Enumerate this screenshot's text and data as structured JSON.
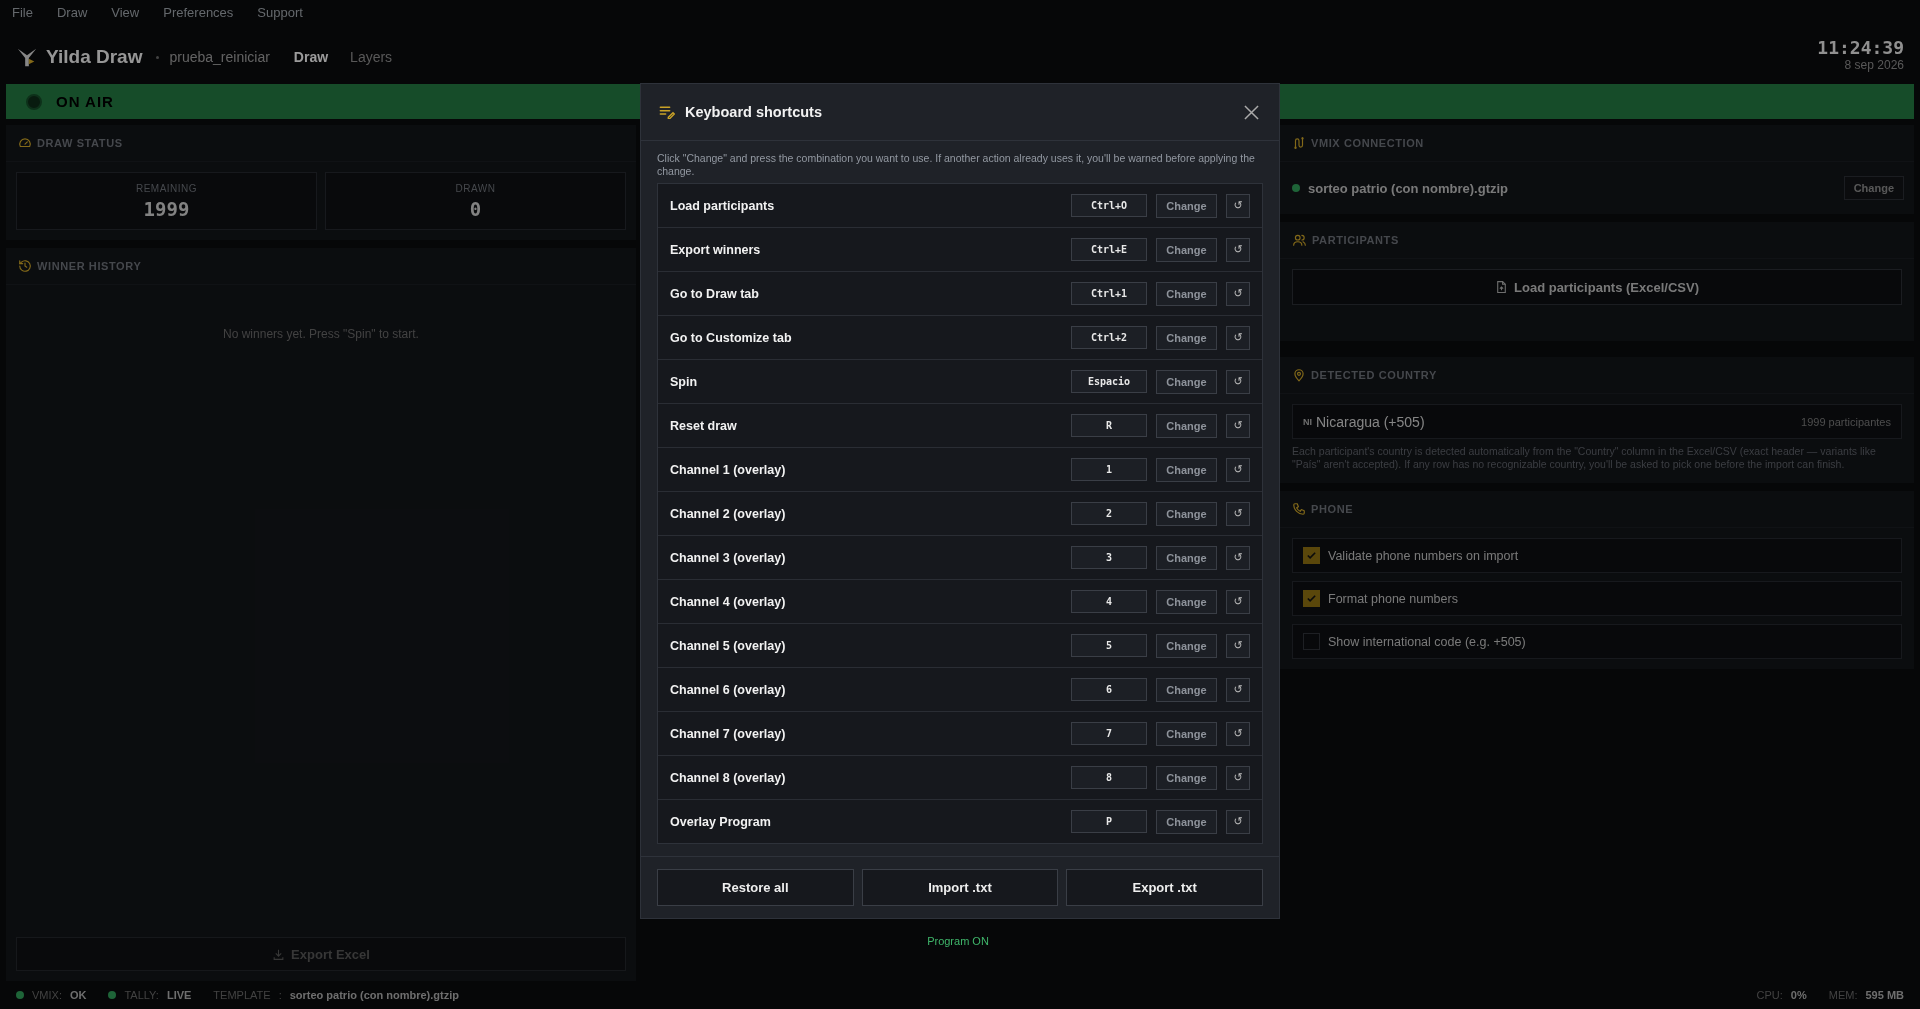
{
  "menu": [
    "File",
    "Draw",
    "View",
    "Preferences",
    "Support"
  ],
  "header": {
    "app_name": "Yilda Draw",
    "project": "prueba_reiniciar",
    "tabs": [
      {
        "label": "Draw",
        "selected": true
      },
      {
        "label": "Layers",
        "selected": false
      }
    ],
    "time": "11:24:39",
    "date": "8 sep 2026"
  },
  "on_air": {
    "label": "ON AIR"
  },
  "draw_status": {
    "title": "DRAW STATUS",
    "stats": [
      {
        "label": "REMAINING",
        "value": "1999"
      },
      {
        "label": "DRAWN",
        "value": "0"
      }
    ]
  },
  "winner_history": {
    "title": "WINNER HISTORY",
    "empty_text": "No winners yet. Press \"Spin\" to start.",
    "export_button": "Export Excel"
  },
  "program_status": "Program ON",
  "vmix_connection": {
    "title": "VMIX CONNECTION",
    "file": "sorteo patrio (con nombre).gtzip",
    "button": "Change"
  },
  "participants": {
    "title": "PARTICIPANTS",
    "button": "Load participants (Excel/CSV)"
  },
  "detected_country": {
    "title": "DETECTED COUNTRY",
    "code": "NI",
    "country": "Nicaragua (+505)",
    "count": "1999 participantes",
    "note": "Each participant's country is detected automatically from the \"Country\" column in the Excel/CSV (exact header — variants like \"País\" aren't accepted). If any row has no recognizable country, you'll be asked to pick one before the import can finish."
  },
  "phone": {
    "title": "PHONE",
    "options": [
      {
        "label": "Validate phone numbers on import",
        "checked": true
      },
      {
        "label": "Format phone numbers",
        "checked": true
      },
      {
        "label": "Show international code (e.g. +505)",
        "checked": false
      }
    ]
  },
  "status_bar": {
    "items": [
      {
        "label": "VMIX:",
        "value": "OK"
      },
      {
        "label": "TALLY:",
        "value": "LIVE"
      }
    ],
    "template_label": "TEMPLATE",
    "template_sep": ":",
    "template_value": "sorteo patrio (con nombre).gtzip",
    "cpu_label": "CPU:",
    "cpu_value": "0%",
    "mem_label": "MEM:",
    "mem_value": "595 MB"
  },
  "modal": {
    "title": "Keyboard shortcuts",
    "description": "Click \"Change\" and press the combination you want to use. If another action already uses it, you'll be warned before applying the change.",
    "shortcuts": [
      {
        "action": "Load participants",
        "key": "Ctrl+O",
        "button": "Change",
        "reset": "↺"
      },
      {
        "action": "Export winners",
        "key": "Ctrl+E",
        "button": "Change",
        "reset": "↺"
      },
      {
        "action": "Go to Draw tab",
        "key": "Ctrl+1",
        "button": "Change",
        "reset": "↺"
      },
      {
        "action": "Go to Customize tab",
        "key": "Ctrl+2",
        "button": "Change",
        "reset": "↺"
      },
      {
        "action": "Spin",
        "key": "Espacio",
        "button": "Change",
        "reset": "↺"
      },
      {
        "action": "Reset draw",
        "key": "R",
        "button": "Change",
        "reset": "↺"
      },
      {
        "action": "Channel 1 (overlay)",
        "key": "1",
        "button": "Change",
        "reset": "↺"
      },
      {
        "action": "Channel 2 (overlay)",
        "key": "2",
        "button": "Change",
        "reset": "↺"
      },
      {
        "action": "Channel 3 (overlay)",
        "key": "3",
        "button": "Change",
        "reset": "↺"
      },
      {
        "action": "Channel 4 (overlay)",
        "key": "4",
        "button": "Change",
        "reset": "↺"
      },
      {
        "action": "Channel 5 (overlay)",
        "key": "5",
        "button": "Change",
        "reset": "↺"
      },
      {
        "action": "Channel 6 (overlay)",
        "key": "6",
        "button": "Change",
        "reset": "↺"
      },
      {
        "action": "Channel 7 (overlay)",
        "key": "7",
        "button": "Change",
        "reset": "↺"
      },
      {
        "action": "Channel 8 (overlay)",
        "key": "8",
        "button": "Change",
        "reset": "↺"
      },
      {
        "action": "Overlay Program",
        "key": "P",
        "button": "Change",
        "reset": "↺"
      }
    ],
    "footer_buttons": [
      "Restore all",
      "Import .txt",
      "Export .txt"
    ]
  }
}
